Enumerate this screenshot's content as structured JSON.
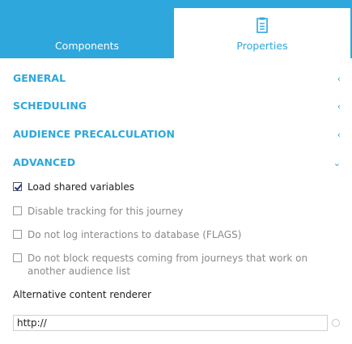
{
  "tabs": {
    "components_label": "Components",
    "properties_label": "Properties",
    "properties_icon": "clipboard-icon"
  },
  "sections": {
    "general": "GENERAL",
    "scheduling": "SCHEDULING",
    "audience": "AUDIENCE PRECALCULATION",
    "advanced": "ADVANCED"
  },
  "advanced": {
    "options": [
      {
        "label": "Load shared variables",
        "checked": true
      },
      {
        "label": "Disable tracking for this journey",
        "checked": false
      },
      {
        "label": "Do not log interactions to database (FLAGS)",
        "checked": false
      },
      {
        "label": "Do not block requests coming from journeys that work on another audience list",
        "checked": false
      }
    ],
    "renderer_label": "Alternative content renderer",
    "renderer_value": "http://"
  },
  "colors": {
    "accent": "#2ea7dc",
    "text": "#222222",
    "muted": "#8a8a8a"
  }
}
